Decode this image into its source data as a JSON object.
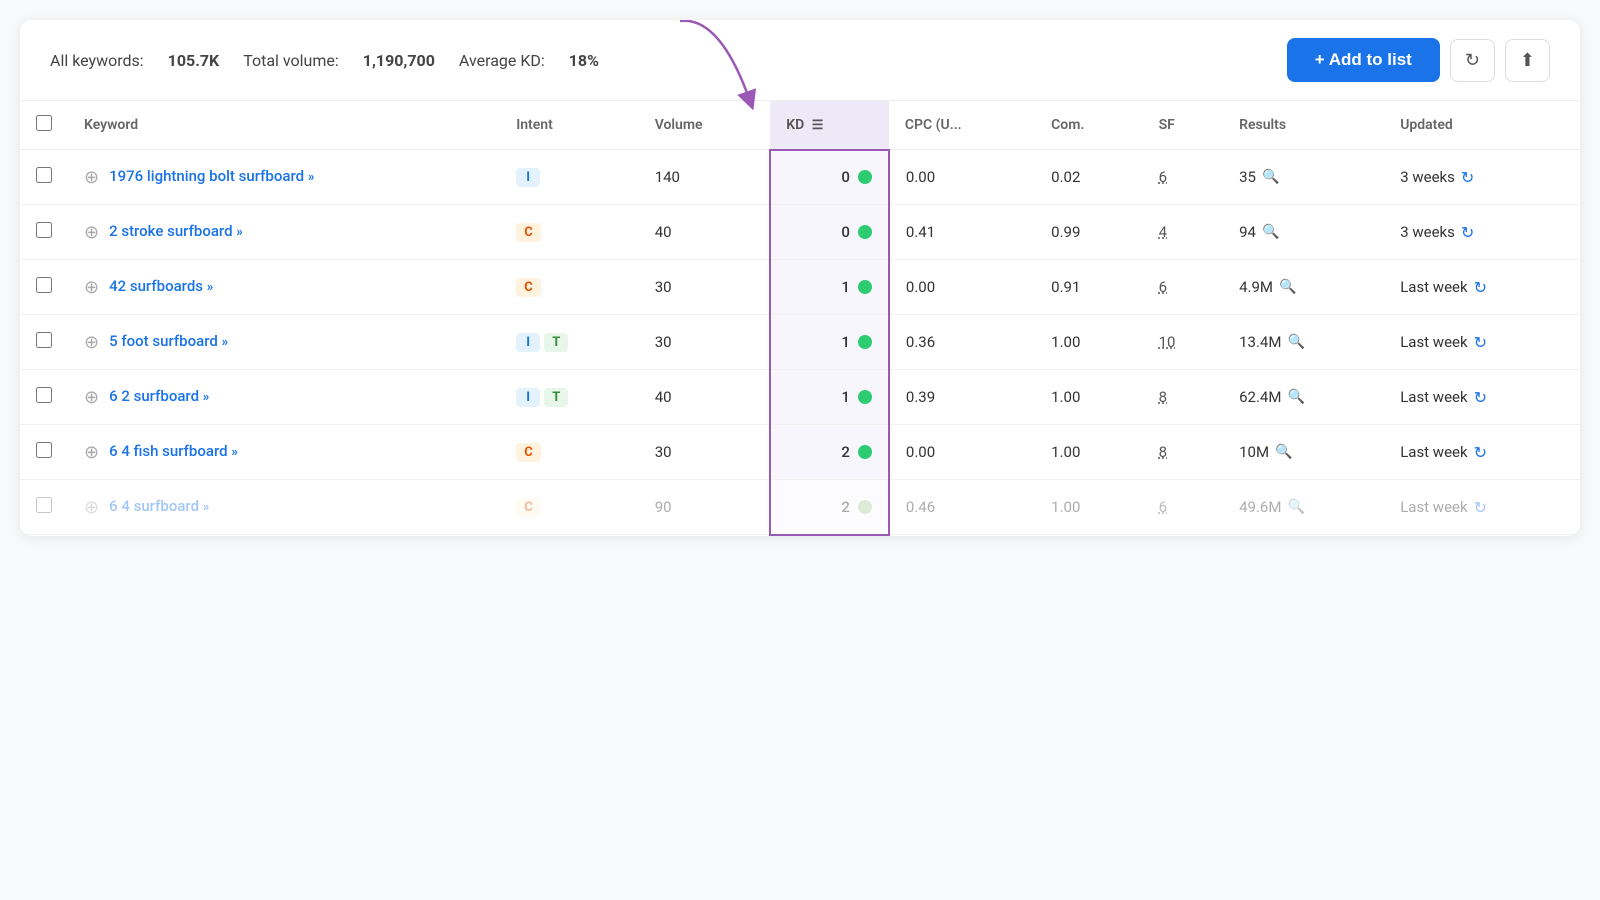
{
  "header": {
    "all_keywords_label": "All keywords:",
    "all_keywords_value": "105.7K",
    "total_volume_label": "Total volume:",
    "total_volume_value": "1,190,700",
    "avg_kd_label": "Average KD:",
    "avg_kd_value": "18%",
    "add_to_list_label": "+ Add to list",
    "refresh_icon": "↻",
    "export_icon": "⬆"
  },
  "columns": {
    "keyword": "Keyword",
    "intent": "Intent",
    "volume": "Volume",
    "kd": "KD",
    "cpc": "CPC (U...",
    "com": "Com.",
    "sf": "SF",
    "results": "Results",
    "updated": "Updated"
  },
  "rows": [
    {
      "keyword": "1976 lightning bolt surfboard",
      "intent": [
        "I"
      ],
      "volume": "140",
      "kd": "0",
      "kd_dot": "green",
      "cpc": "0.00",
      "com": "0.02",
      "sf": "6",
      "results": "35",
      "updated": "3 weeks"
    },
    {
      "keyword": "2 stroke surfboard",
      "intent": [
        "C"
      ],
      "volume": "40",
      "kd": "0",
      "kd_dot": "green",
      "cpc": "0.41",
      "com": "0.99",
      "sf": "4",
      "results": "94",
      "updated": "3 weeks"
    },
    {
      "keyword": "42 surfboards",
      "intent": [
        "C"
      ],
      "volume": "30",
      "kd": "1",
      "kd_dot": "green",
      "cpc": "0.00",
      "com": "0.91",
      "sf": "6",
      "results": "4.9M",
      "updated": "Last week"
    },
    {
      "keyword": "5 foot surfboard",
      "intent": [
        "I",
        "T"
      ],
      "volume": "30",
      "kd": "1",
      "kd_dot": "green",
      "cpc": "0.36",
      "com": "1.00",
      "sf": "10",
      "results": "13.4M",
      "updated": "Last week"
    },
    {
      "keyword": "6 2 surfboard",
      "intent": [
        "I",
        "T"
      ],
      "volume": "40",
      "kd": "1",
      "kd_dot": "green",
      "cpc": "0.39",
      "com": "1.00",
      "sf": "8",
      "results": "62.4M",
      "updated": "Last week"
    },
    {
      "keyword": "6 4 fish surfboard",
      "intent": [
        "C"
      ],
      "volume": "30",
      "kd": "2",
      "kd_dot": "green",
      "cpc": "0.00",
      "com": "1.00",
      "sf": "8",
      "results": "10M",
      "updated": "Last week"
    },
    {
      "keyword": "6 4 surfboard",
      "intent": [
        "C"
      ],
      "volume": "90",
      "kd": "2",
      "kd_dot": "gray",
      "cpc": "0.46",
      "com": "1.00",
      "sf": "6",
      "results": "49.6M",
      "updated": "Last week",
      "dimmed": true
    }
  ]
}
